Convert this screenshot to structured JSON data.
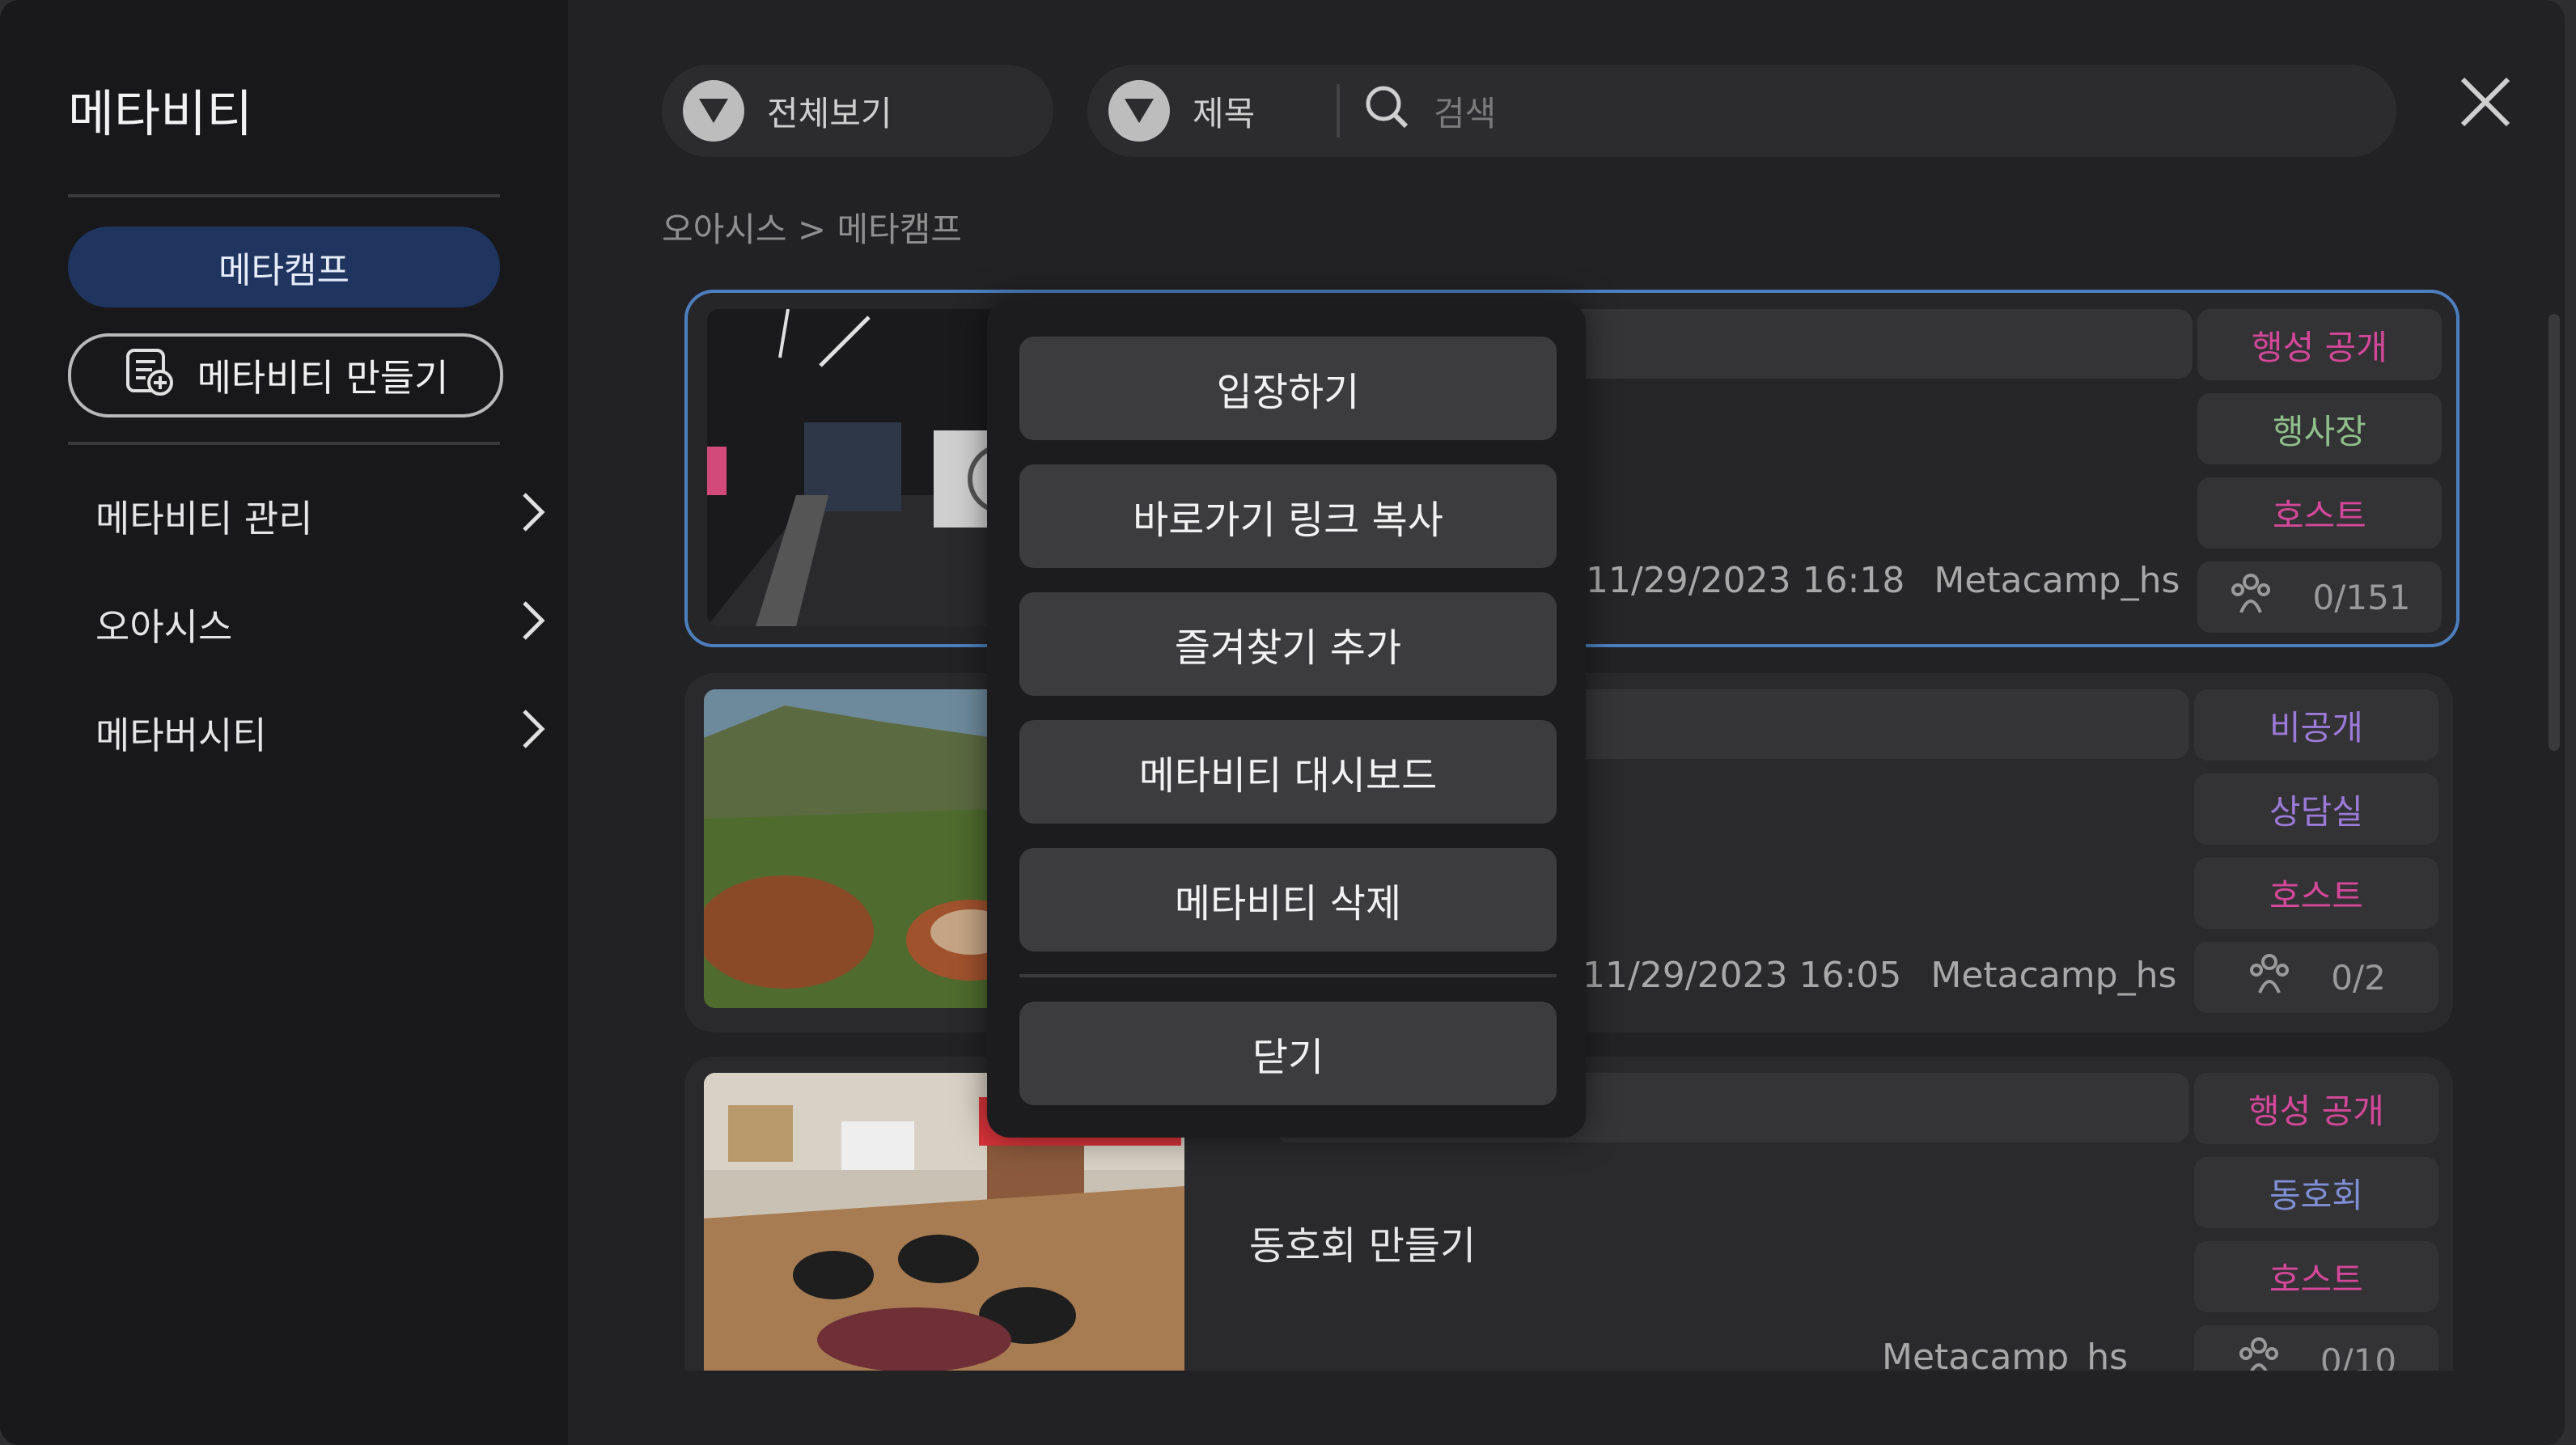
{
  "sidebar": {
    "title": "메타비티",
    "camp_button": "메타캠프",
    "create_button": "메타비티 만들기",
    "items": [
      {
        "label": "메타비티 관리"
      },
      {
        "label": "오아시스"
      },
      {
        "label": "메타버시티"
      }
    ]
  },
  "header": {
    "filter_label": "전체보기",
    "field_label": "제목",
    "search_placeholder": "검색"
  },
  "breadcrumb": "오아시스 > 메타캠프",
  "cards": [
    {
      "title": "",
      "date": "11/29/2023 16:18",
      "owner": "Metacamp_hs",
      "visibility": "행성 공개",
      "type": "행사장",
      "role": "호스트",
      "count": "0/151"
    },
    {
      "title": "",
      "date": "11/29/2023 16:05",
      "owner": "Metacamp_hs",
      "visibility": "비공개",
      "type": "상담실",
      "role": "호스트",
      "count": "0/2"
    },
    {
      "title": "동호회 만들기",
      "date": "",
      "owner": "Metacamp_hs",
      "visibility": "행성 공개",
      "type": "동호회",
      "role": "호스트",
      "count": "0/10"
    }
  ],
  "context_menu": {
    "enter": "입장하기",
    "copy_link": "바로가기 링크 복사",
    "add_favorite": "즐겨찾기 추가",
    "dashboard": "메타비티 대시보드",
    "delete": "메타비티 삭제",
    "close": "닫기"
  },
  "colors": {
    "accent": "#1f3560",
    "selected_border": "#4d7fbf",
    "public_tag": "#d4479a",
    "host_tag": "#d4479a",
    "event_tag": "#8fbf8a",
    "private_tag": "#9b7ad8",
    "club_tag": "#7f8fd6"
  },
  "icons": [
    "dropdown-icon",
    "search-icon",
    "close-icon",
    "chevron-right-icon",
    "create-document-icon",
    "people-icon"
  ]
}
